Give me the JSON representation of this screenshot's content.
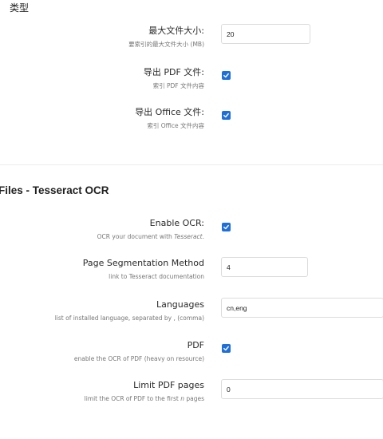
{
  "top": {
    "type_label": "类型"
  },
  "basic": {
    "max_file_size": {
      "label": "最大文件大小:",
      "help": "要索引的最大文件大小 (MB)",
      "value": "20"
    },
    "export_pdf": {
      "label": "导出 PDF 文件:",
      "help": "索引 PDF 文件内容",
      "checked": true
    },
    "export_office": {
      "label": "导出 Office 文件:",
      "help": "索引 Office 文件内容",
      "checked": true
    }
  },
  "ocr_section": {
    "title": "Files - Tesseract OCR",
    "enable_ocr": {
      "label": "Enable OCR:",
      "help_prefix": "OCR your document with ",
      "help_em": "Tesseract",
      "help_suffix": ".",
      "checked": true
    },
    "page_seg": {
      "label": "Page Segmentation Method",
      "help": "link to Tesseract documentation",
      "value": "4"
    },
    "languages": {
      "label": "Languages",
      "help": "list of installed language, separated by , (comma)",
      "value": "cn,eng"
    },
    "pdf": {
      "label": "PDF",
      "help": "enable the OCR of PDF (heavy on resource)",
      "checked": true
    },
    "limit_pdf_pages": {
      "label": "Limit PDF pages",
      "help_prefix": "limit the OCR of PDF to the first ",
      "help_em": "n",
      "help_suffix": " pages",
      "value": "0"
    }
  },
  "colors": {
    "accent": "#1e6fd9",
    "border": "#dcdcdc",
    "help_text": "#777777"
  }
}
